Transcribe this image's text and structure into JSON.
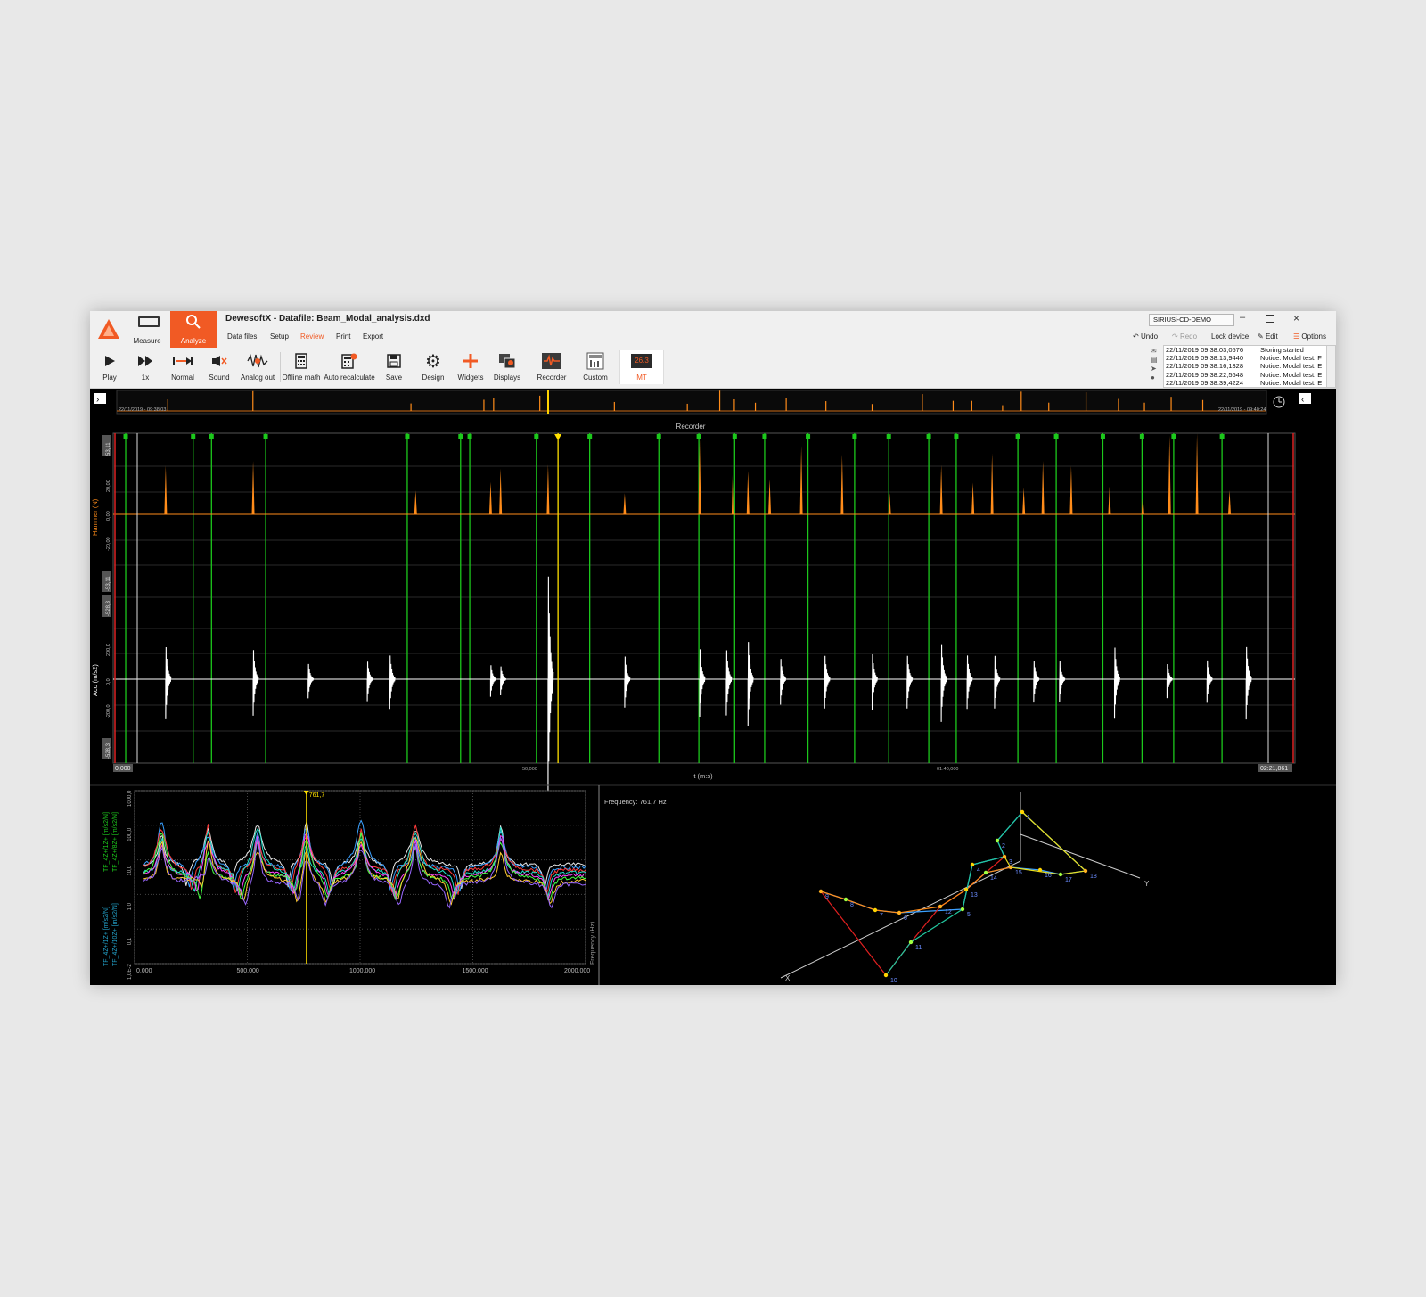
{
  "window": {
    "title": "DewesoftX - Datafile: Beam_Modal_analysis.dxd",
    "device": "SIRIUSi-CD-DEMO"
  },
  "modes": [
    {
      "label": "Measure",
      "icon": "measure-icon"
    },
    {
      "label": "Analyze",
      "icon": "search-icon"
    }
  ],
  "menu": [
    "Data files",
    "Setup",
    "Review",
    "Print",
    "Export"
  ],
  "active_menu": "Review",
  "right_tools": {
    "undo": "Undo",
    "redo": "Redo",
    "lock": "Lock device",
    "edit": "Edit",
    "options": "Options"
  },
  "toolbar": [
    {
      "label": "Play",
      "icon": "play-icon"
    },
    {
      "label": "1x",
      "icon": "fast-forward-icon"
    },
    {
      "label": "Normal",
      "icon": "normal-mode-icon"
    },
    {
      "label": "Sound",
      "icon": "speaker-mute-icon"
    },
    {
      "label": "Analog out",
      "icon": "analog-out-icon"
    },
    {
      "label": "Offline math",
      "icon": "calculator-icon"
    },
    {
      "label": "Auto recalculate",
      "icon": "calculator-refresh-icon"
    },
    {
      "label": "Save",
      "icon": "save-icon"
    },
    {
      "label": "Design",
      "icon": "gear-icon"
    },
    {
      "label": "Widgets",
      "icon": "plus-icon"
    },
    {
      "label": "Displays",
      "icon": "displays-icon"
    },
    {
      "label": "Recorder",
      "icon": "recorder-icon"
    },
    {
      "label": "Custom",
      "icon": "custom-icon"
    },
    {
      "label": "MT",
      "icon": "mt-icon",
      "icon_text": "26.3"
    }
  ],
  "event_log": [
    {
      "time": "22/11/2019 09:38:03,0576",
      "msg": "Storing started"
    },
    {
      "time": "22/11/2019 09:38:13,9440",
      "msg": "Notice: Modal test: F"
    },
    {
      "time": "22/11/2019 09:38:16,1328",
      "msg": "Notice: Modal test: E"
    },
    {
      "time": "22/11/2019 09:38:22,5648",
      "msg": "Notice: Modal test: E"
    },
    {
      "time": "22/11/2019 09:38:39,4224",
      "msg": "Notice: Modal test: E"
    }
  ],
  "overview": {
    "start": "22/11/2019 - 09:38:03",
    "end": "22/11/2019 - 09:40:24"
  },
  "recorder": {
    "title": "Recorder",
    "xlabel": "t (m:s)",
    "x_start": "0,000",
    "x_mid": "50,000",
    "x_mid2": "01:40,000",
    "x_end": "02:21,861",
    "hammer_label": "Hammer (N)",
    "hammer_max": "53,11",
    "hammer_ticks": [
      "20,00",
      "0,00",
      "-20,00"
    ],
    "acc_label": "Acc (m/s2)",
    "acc_max": "-53,11",
    "acc_top": "-528,3",
    "acc_ticks": [
      "200,0",
      "0,0",
      "-200,0"
    ],
    "acc_min": "-528,3"
  },
  "chart_data": [
    {
      "type": "line",
      "title": "Recorder",
      "xlabel": "t (m:s)",
      "xlim": [
        0,
        141.861
      ],
      "series": [
        {
          "name": "Hammer (N)",
          "impacts_s": [
            6.3,
            16.8,
            36.3,
            45.3,
            46.5,
            52.2,
            61.4,
            70.4,
            74.4,
            76.2,
            78.8,
            82.6,
            87.5,
            93.2,
            99.4,
            103.2,
            105.5,
            109.3,
            111.6,
            115.0,
            119.6,
            123.6,
            126.8,
            130.1,
            134.0
          ]
        },
        {
          "name": "Acc (m/s2)",
          "impacts_s": [
            6.3,
            16.8,
            23.4,
            30.5,
            33.2,
            45.3,
            46.5,
            52.2,
            61.4,
            70.4,
            73.6,
            76.2,
            80.1,
            85.4,
            91.1,
            95.3,
            99.4,
            102.5,
            105.8,
            110.5,
            113.6,
            120.2,
            126.5,
            131.3,
            136.0
          ]
        }
      ],
      "markers_s": [
        1.5,
        9.6,
        11.8,
        18.3,
        35.3,
        41.7,
        42.8,
        50.8,
        57.2,
        65.5,
        70.3,
        74.6,
        78.2,
        83.4,
        89.0,
        93.1,
        97.9,
        101.2,
        108.6,
        113.2,
        118.8,
        123.5,
        127.3,
        133.1
      ],
      "cursor_s": 53.4,
      "ylim_hammer": [
        -53.11,
        53.11
      ],
      "ylim_acc": [
        -528.3,
        528.3
      ]
    },
    {
      "type": "line",
      "title": "",
      "xlabel": "",
      "ylabel": "Frequency (Hz)",
      "xlim": [
        0,
        2000
      ],
      "x_ticks": [
        "0,000",
        "500,000",
        "1000,000",
        "1500,000",
        "2000,000"
      ],
      "y_ticks": [
        "1000,0",
        "100,0",
        "10,0",
        "1,0",
        "0,1",
        "1,0E-2"
      ],
      "cursor_label": "761,7",
      "cursor_x": 761.7,
      "y_labels": [
        "TF_4Z+/1Z+ [m/s2/N]",
        "TF_4Z+/8Z+ [m/s2/N]",
        "TF_4Z+/1Z+ [m/s2/N]",
        "TF_4Z+/10Z+ [m/s2/N]"
      ],
      "resonances_hz": [
        120,
        325,
        545,
        761.7,
        1005,
        1245,
        1625
      ],
      "series_colors": [
        "#e8e8e8",
        "#3aa0ff",
        "#ff3a3a",
        "#22e0c8",
        "#ff44ff",
        "#44ff44",
        "#ffcc33",
        "#9966ff"
      ]
    }
  ],
  "mode_shape": {
    "frequency_text": "Frequency: 761,7 Hz",
    "axes": [
      "X",
      "Y"
    ],
    "nodes": [
      "1",
      "2",
      "3",
      "4",
      "5",
      "6",
      "7",
      "8",
      "9",
      "10",
      "11",
      "12",
      "13",
      "14",
      "15",
      "16",
      "17",
      "18"
    ]
  },
  "colors": {
    "accent": "#f15a24",
    "hammer": "#ff8c1a",
    "acc": "#ffffff",
    "marker": "#1cc81c",
    "cursor": "#ffe000"
  }
}
